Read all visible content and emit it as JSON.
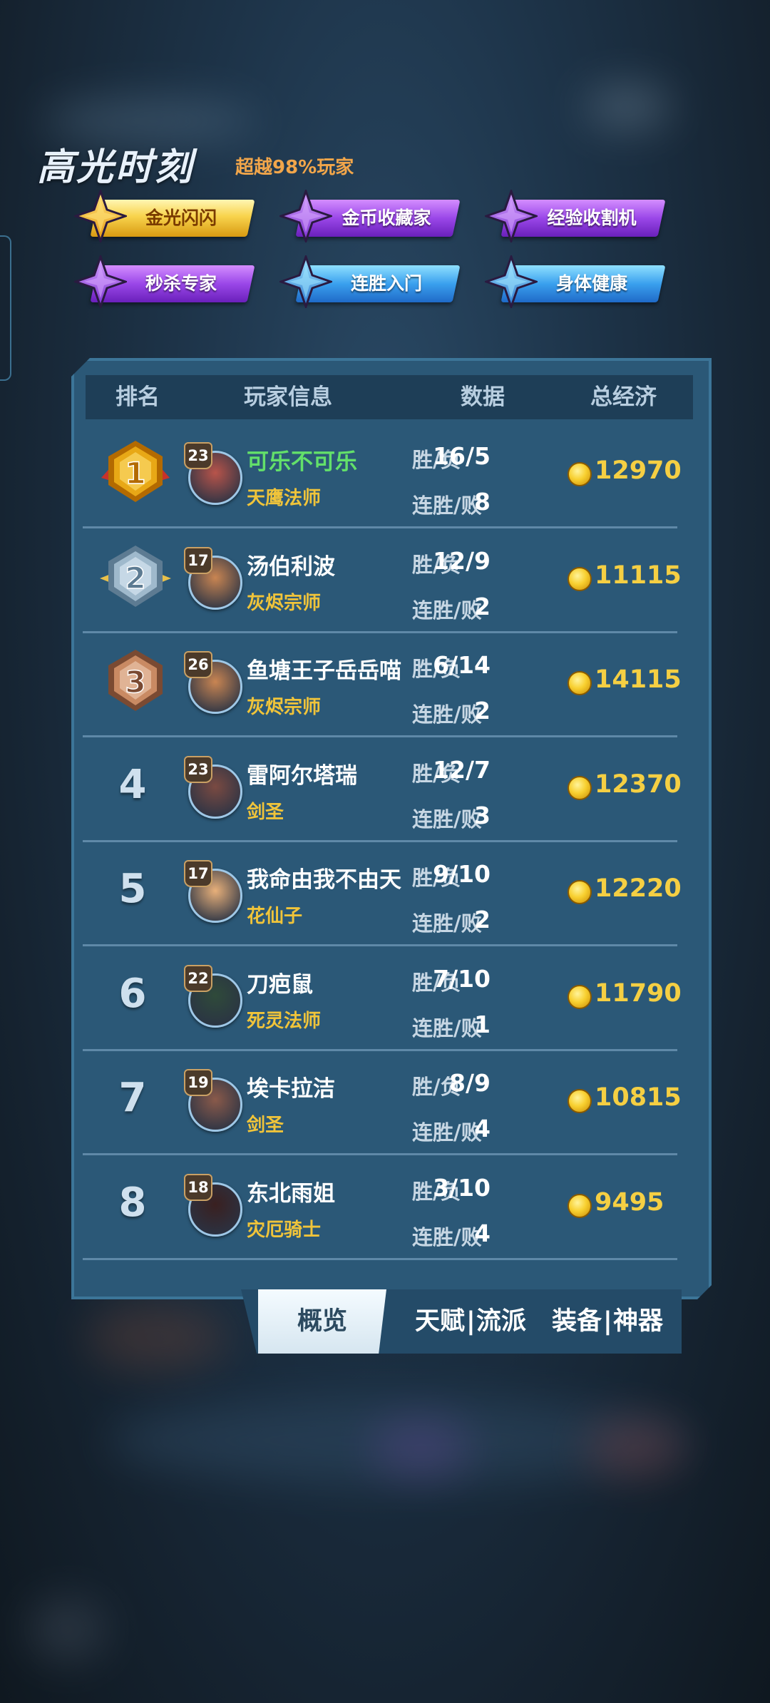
{
  "highlights": {
    "title": "高光时刻",
    "subtitle": "超越98%玩家",
    "badges": [
      {
        "label": "金光闪闪",
        "style": "gold"
      },
      {
        "label": "金币收藏家",
        "style": "purple"
      },
      {
        "label": "经验收割机",
        "style": "purple"
      },
      {
        "label": "秒杀专家",
        "style": "purple"
      },
      {
        "label": "连胜入门",
        "style": "blue"
      },
      {
        "label": "身体健康",
        "style": "blue"
      }
    ]
  },
  "table": {
    "headers": {
      "rank": "排名",
      "player": "玩家信息",
      "data": "数据",
      "economy": "总经济"
    },
    "stat_labels": {
      "win_loss": "胜/负",
      "streak": "连胜/败"
    },
    "rows": [
      {
        "rank": "1",
        "level": "23",
        "name": "可乐不可乐",
        "class": "天鹰法师",
        "win_loss": "16/5",
        "streak": "8",
        "economy": "12970"
      },
      {
        "rank": "2",
        "level": "17",
        "name": "汤伯利波",
        "class": "灰烬宗师",
        "win_loss": "12/9",
        "streak": "2",
        "economy": "11115"
      },
      {
        "rank": "3",
        "level": "26",
        "name": "鱼塘王子岳岳喵",
        "class": "灰烬宗师",
        "win_loss": "6/14",
        "streak": "2",
        "economy": "14115"
      },
      {
        "rank": "4",
        "level": "23",
        "name": "雷阿尔塔瑞",
        "class": "剑圣",
        "win_loss": "12/7",
        "streak": "3",
        "economy": "12370"
      },
      {
        "rank": "5",
        "level": "17",
        "name": "我命由我不由天",
        "class": "花仙子",
        "win_loss": "9/10",
        "streak": "2",
        "economy": "12220"
      },
      {
        "rank": "6",
        "level": "22",
        "name": "刀疤鼠",
        "class": "死灵法师",
        "win_loss": "7/10",
        "streak": "1",
        "economy": "11790"
      },
      {
        "rank": "7",
        "level": "19",
        "name": "埃卡拉洁",
        "class": "剑圣",
        "win_loss": "8/9",
        "streak": "4",
        "economy": "10815"
      },
      {
        "rank": "8",
        "level": "18",
        "name": "东北雨姐",
        "class": "灾厄骑士",
        "win_loss": "3/10",
        "streak": "4",
        "economy": "9495"
      }
    ]
  },
  "tabs": {
    "overview": "概览",
    "talent": "天赋",
    "school": "流派",
    "equipment": "装备",
    "artifact": "神器",
    "separator": "|"
  }
}
